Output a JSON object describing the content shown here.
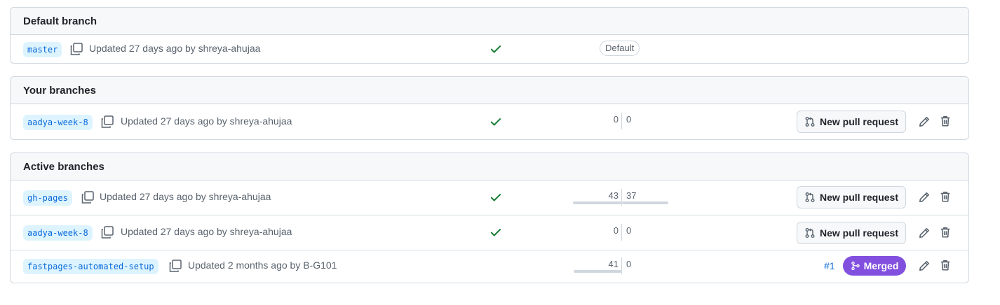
{
  "sections": {
    "default": {
      "title": "Default branch",
      "rows": [
        {
          "branch": "master",
          "updated": "Updated 27 days ago by shreya-ahujaa",
          "status": "passing",
          "badge": "Default"
        }
      ]
    },
    "yours": {
      "title": "Your branches",
      "rows": [
        {
          "branch": "aadya-week-8",
          "updated": "Updated 27 days ago by shreya-ahujaa",
          "status": "passing",
          "behind": "0",
          "ahead": "0",
          "action": "New pull request"
        }
      ]
    },
    "active": {
      "title": "Active branches",
      "rows": [
        {
          "branch": "gh-pages",
          "updated": "Updated 27 days ago by shreya-ahujaa",
          "status": "passing",
          "behind": "43",
          "ahead": "37",
          "action": "New pull request"
        },
        {
          "branch": "aadya-week-8",
          "updated": "Updated 27 days ago by shreya-ahujaa",
          "status": "passing",
          "behind": "0",
          "ahead": "0",
          "action": "New pull request"
        },
        {
          "branch": "fastpages-automated-setup",
          "updated": "Updated 2 months ago by B-G101",
          "behind": "41",
          "ahead": "0",
          "pr_number": "#1",
          "pr_state": "Merged"
        }
      ]
    }
  },
  "colors": {
    "link": "#0969da",
    "success": "#1a7f37",
    "merged": "#8250df",
    "border": "#d0d7de",
    "muted": "#59636e"
  },
  "icons": {
    "copy": "copy-icon",
    "check": "check-icon",
    "pull_request": "git-pull-request-icon",
    "merge": "git-merge-icon",
    "edit": "pencil-icon",
    "delete": "trash-icon"
  }
}
